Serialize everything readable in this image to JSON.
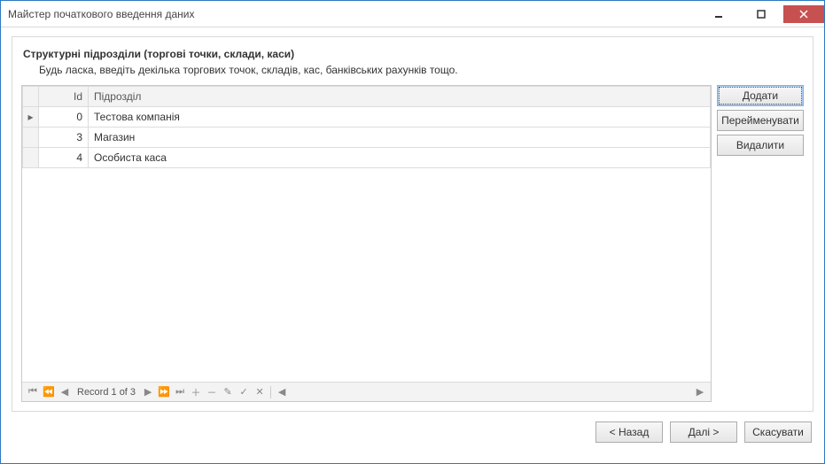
{
  "window": {
    "title": "Майстер початкового введення даних"
  },
  "page": {
    "heading": "Структурні підрозділи (торгові точки, склади, каси)",
    "subtext": "Будь ласка, введіть декілька торгових точок, складів, кас, банківських рахунків тощо."
  },
  "grid": {
    "columns": {
      "id": "Id",
      "unit": "Підрозділ"
    },
    "rows": [
      {
        "id": "0",
        "unit": "Тестова компанія"
      },
      {
        "id": "3",
        "unit": "Магазин"
      },
      {
        "id": "4",
        "unit": "Особиста каса"
      }
    ],
    "nav_text": "Record 1 of 3"
  },
  "buttons": {
    "add": "Додати",
    "rename": "Перейменувати",
    "delete": "Видалити",
    "back": "< Назад",
    "next": "Далі >",
    "cancel": "Скасувати"
  }
}
